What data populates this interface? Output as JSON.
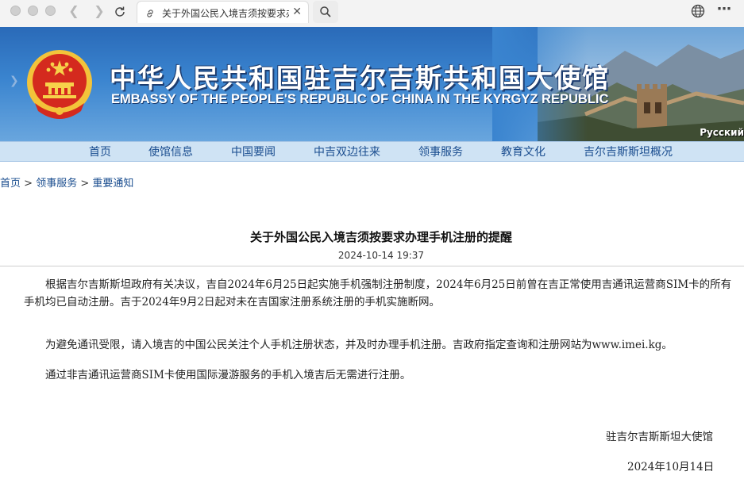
{
  "browser": {
    "tab_title": "关于外国公民入境吉须按要求办理手机",
    "icons": [
      "back-icon",
      "forward-icon",
      "reload-icon",
      "link-icon",
      "close-icon",
      "search-icon",
      "globe-icon",
      "more-icon"
    ]
  },
  "banner": {
    "title_cn": "中华人民共和国驻吉尔吉斯共和国大使馆",
    "title_en": "EMBASSY OF THE PEOPLE'S REPUBLIC OF CHINA IN THE KYRGYZ REPUBLIC",
    "lang_link": "Русский"
  },
  "nav": {
    "items": [
      "首页",
      "使馆信息",
      "中国要闻",
      "中吉双边往来",
      "领事服务",
      "教育文化",
      "吉尔吉斯斯坦概况"
    ]
  },
  "breadcrumb": {
    "home": "首页",
    "sep": " > ",
    "section": "领事服务",
    "page": "重要通知"
  },
  "article": {
    "title": "关于外国公民入境吉须按要求办理手机注册的提醒",
    "date": "2024-10-14 19:37",
    "paragraphs": [
      "根据吉尔吉斯斯坦政府有关决议，吉自2024年6月25日起实施手机强制注册制度，2024年6月25日前曾在吉正常使用吉通讯运营商SIM卡的所有手机均已自动注册。吉于2024年9月2日起对未在吉国家注册系统注册的手机实施断网。",
      "为避免通讯受限，请入境吉的中国公民关注个人手机注册状态，并及时办理手机注册。吉政府指定查询和注册网站为www.imei.kg。",
      "通过非吉通讯运营商SIM卡使用国际漫游服务的手机入境吉后无需进行注册。"
    ],
    "signature": "驻吉尔吉斯斯坦大使馆",
    "sign_date": "2024年10月14日"
  },
  "colors": {
    "banner_blue": "#3a84cf",
    "nav_bg": "#cfe3f4",
    "link_blue": "#1a4d8f",
    "emblem_red": "#d42a1e",
    "emblem_gold": "#f3c33a"
  }
}
